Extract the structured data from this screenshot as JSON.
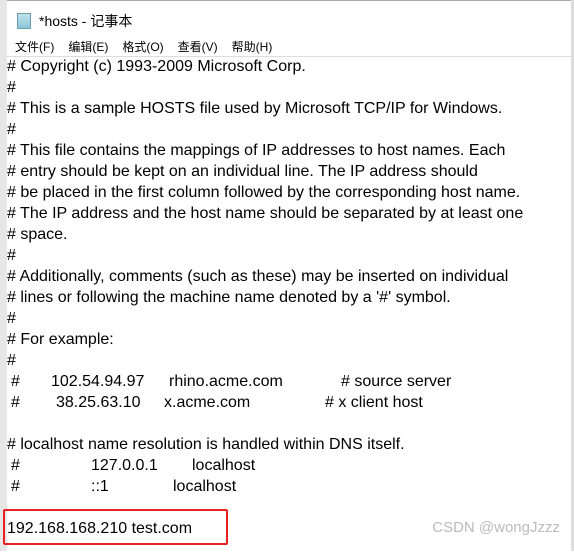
{
  "window": {
    "title": "*hosts - 记事本",
    "icon": "notepad-icon"
  },
  "menu": [
    "文件(F)",
    "编辑(E)",
    "格式(O)",
    "查看(V)",
    "帮助(H)"
  ],
  "lines": [
    "# Copyright (c) 1993-2009 Microsoft Corp.",
    "#",
    "# This is a sample HOSTS file used by Microsoft TCP/IP for Windows.",
    "#",
    "# This file contains the mappings of IP addresses to host names. Each",
    "# entry should be kept on an individual line. The IP address should",
    "# be placed in the first column followed by the corresponding host name.",
    "# The IP address and the host name should be separated by at least one",
    "# space.",
    "#",
    "# Additionally, comments (such as these) may be inserted on individual",
    "# lines or following the machine name denoted by a '#' symbol.",
    "#",
    "# For example:",
    "#"
  ],
  "examples": [
    {
      "hash": "#",
      "ip": "102.54.94.97",
      "host": "rhino.acme.com",
      "comment": "# source server"
    },
    {
      "hash": "#",
      "ip": "38.25.63.10",
      "host": "x.acme.com",
      "comment": "# x client host"
    }
  ],
  "localhost_comment": "# localhost name resolution is handled within DNS itself.",
  "localhost": [
    {
      "hash": "#",
      "ip": "127.0.0.1",
      "host": "localhost"
    },
    {
      "hash": "#",
      "ip": "::1",
      "host": "localhost"
    }
  ],
  "added_entry": "192.168.168.210 test.com",
  "highlight_color": "#e8231f",
  "watermark": "CSDN @wongJzzz"
}
